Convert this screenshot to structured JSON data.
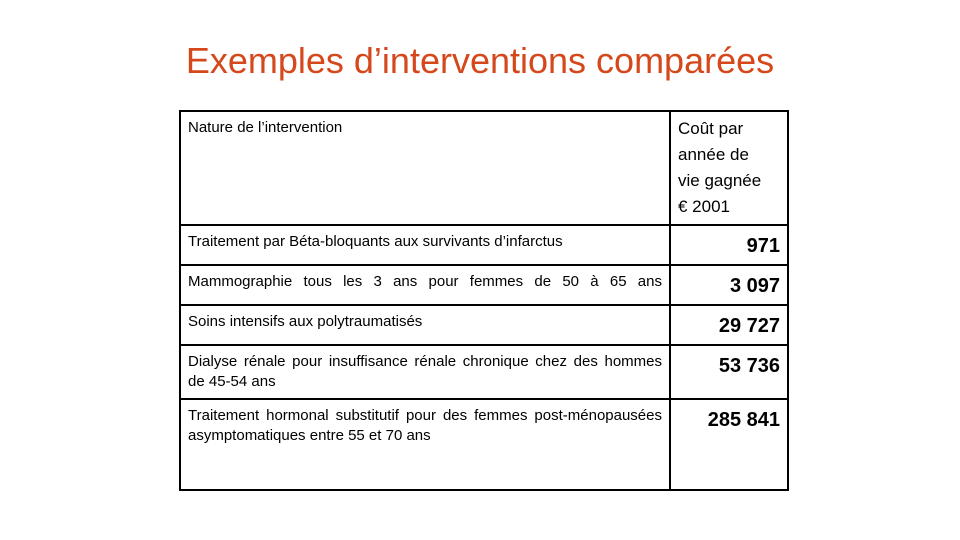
{
  "title": "Exemples d’interventions comparées",
  "colors": {
    "title": "#D5481B",
    "border": "#000000",
    "background": "#FFFFFF"
  },
  "table": {
    "header": {
      "nature": "Nature de l’intervention",
      "cost_lines": [
        "Coût par",
        "année de",
        "vie gagnée",
        "€ 2001"
      ]
    },
    "rows": [
      {
        "label": "Traitement par Béta-bloquants aux survivants d’infarctus",
        "value": "971"
      },
      {
        "label": "Mammographie tous les 3 ans pour femmes de 50 à 65 ans",
        "value": "3 097"
      },
      {
        "label": "Soins intensifs aux polytraumatisés",
        "value": "29 727"
      },
      {
        "label": "Dialyse rénale pour insuffisance rénale chronique chez des hommes de 45-54 ans",
        "value": "53 736"
      },
      {
        "label": "Traitement hormonal substitutif pour des femmes post-ménopausées asymptomatiques entre 55 et 70 ans",
        "value": "285 841"
      }
    ]
  }
}
